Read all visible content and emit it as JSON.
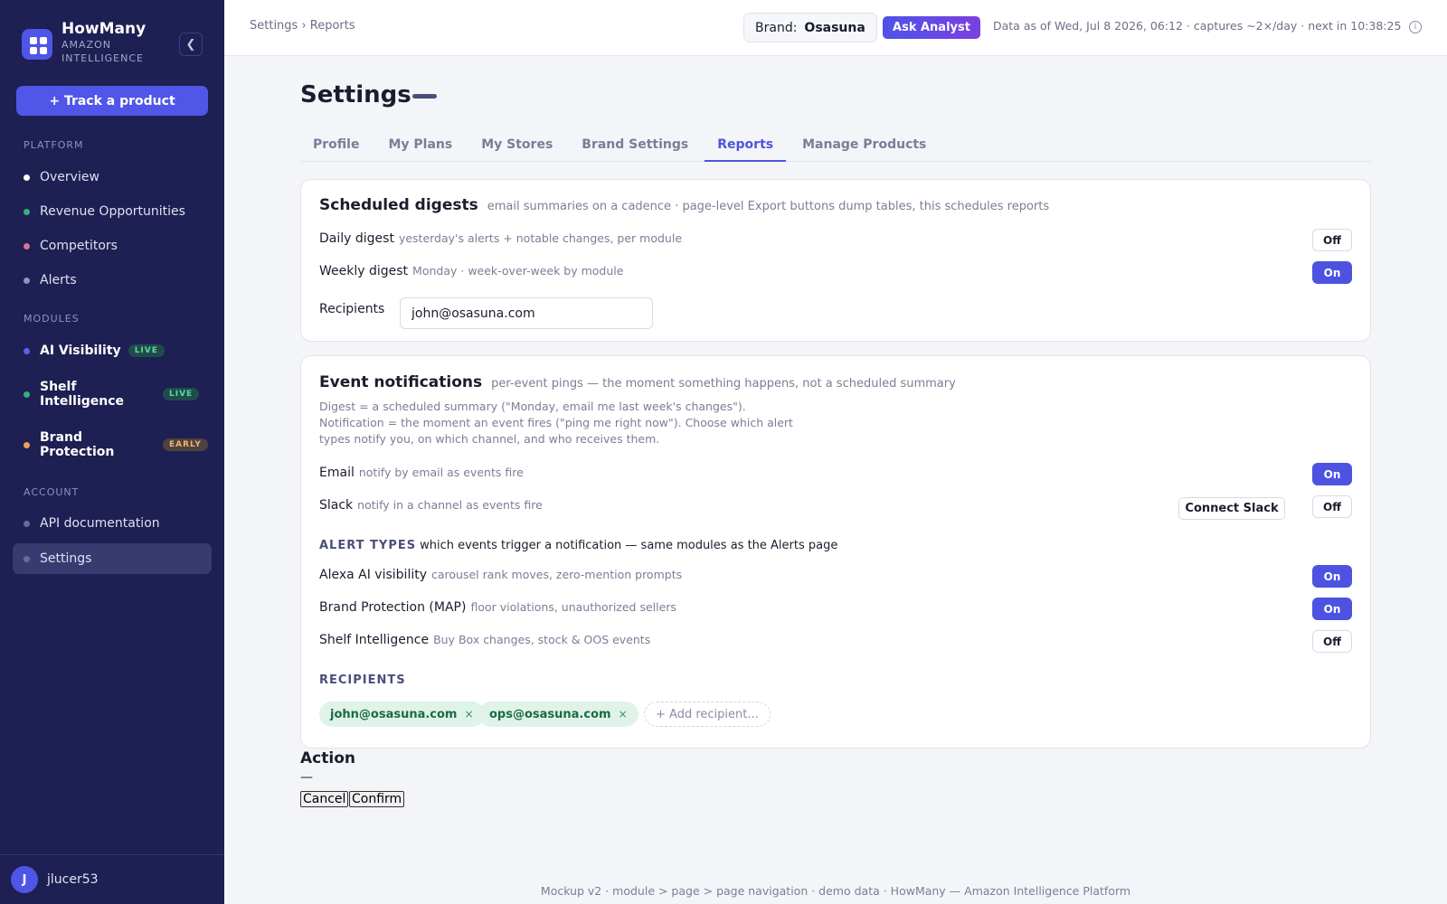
{
  "app": {
    "name": "HowMany",
    "subtitle": "AMAZON INTELLIGENCE",
    "collapse_icon": "chevron-left-icon"
  },
  "sidebar": {
    "track_button": "+ Track a product",
    "platform_label": "PLATFORM",
    "platform": [
      {
        "label": "Overview",
        "dot": "#ffffff"
      },
      {
        "label": "Revenue Opportunities",
        "dot": "#2fb47c"
      },
      {
        "label": "Competitors",
        "dot": "#d9719e"
      },
      {
        "label": "Alerts",
        "dot": "#8c90d6"
      }
    ],
    "modules_label": "MODULES",
    "modules": [
      {
        "label": "AI Visibility",
        "badge": "LIVE",
        "dot": "#5a60f0"
      },
      {
        "label": "Shelf Intelligence",
        "badge": "LIVE",
        "dot": "#2fb47c"
      },
      {
        "label": "Brand Protection",
        "badge": "EARLY",
        "dot": "#f0a24e"
      }
    ],
    "account_label": "ACCOUNT",
    "account": [
      {
        "label": "API documentation",
        "dot": "#676a9e"
      },
      {
        "label": "Settings",
        "dot": "#676a9e"
      }
    ],
    "user": {
      "initial": "J",
      "name": "jlucer53"
    }
  },
  "topbar": {
    "breadcrumb": "Settings › Reports",
    "brand_label": "Brand:",
    "brand_value": "Osasuna",
    "ask_button": "Ask Analyst",
    "data_as_of": "Data as of Wed, Jul 8 2026, 06:12 · captures ~2×/day · next in 10:38:25",
    "info_icon": "info-icon"
  },
  "page": {
    "title": "Settings",
    "tabs": [
      "Profile",
      "My Plans",
      "My Stores",
      "Brand Settings",
      "Reports",
      "Manage Products"
    ],
    "active_tab": "Reports"
  },
  "digests": {
    "title": "Scheduled digests",
    "subtitle": "email summaries on a cadence · page-level Export buttons dump tables, this schedules reports",
    "daily": {
      "label": "Daily digest",
      "desc": "yesterday's alerts + notable changes, per module",
      "state": "Off"
    },
    "weekly": {
      "label": "Weekly digest",
      "desc": "Monday · week-over-week by module",
      "state": "On"
    },
    "recipients_label": "Recipients",
    "recipients_value": "john@osasuna.com"
  },
  "events": {
    "title": "Event notifications",
    "subtitle": "per-event pings — the moment something happens, not a scheduled summary",
    "explain": "Digest = a scheduled summary (\"Monday, email me last week's changes\"). Notification = the moment an event fires (\"ping me right now\"). Choose which alert types notify you, on which channel, and who receives them.",
    "email": {
      "label": "Email",
      "desc": "notify by email as events fire",
      "state": "On"
    },
    "slack": {
      "label": "Slack",
      "desc": "notify in a channel as events fire",
      "state": "Off",
      "connect": "Connect Slack"
    },
    "alert_types_label": "ALERT TYPES",
    "alert_types_desc": "which events trigger a notification — same modules as the Alerts page",
    "alexa": {
      "label": "Alexa AI visibility",
      "desc": "carousel rank moves, zero-mention prompts",
      "state": "On"
    },
    "map": {
      "label": "Brand Protection (MAP)",
      "desc": "floor violations, unauthorized sellers",
      "state": "On"
    },
    "shelf": {
      "label": "Shelf Intelligence",
      "desc": "Buy Box changes, stock & OOS events",
      "state": "Off"
    },
    "recipients_label": "RECIPIENTS",
    "recipients": [
      "john@osasuna.com",
      "ops@osasuna.com"
    ],
    "remove_glyph": "×",
    "add_recipient": "+ Add recipient..."
  },
  "action": {
    "title": "Action",
    "dash": "—",
    "cancel": "Cancel",
    "confirm": "Confirm"
  },
  "footer": "Mockup v2 · module > page > page navigation · demo data · HowMany — Amazon Intelligence Platform"
}
